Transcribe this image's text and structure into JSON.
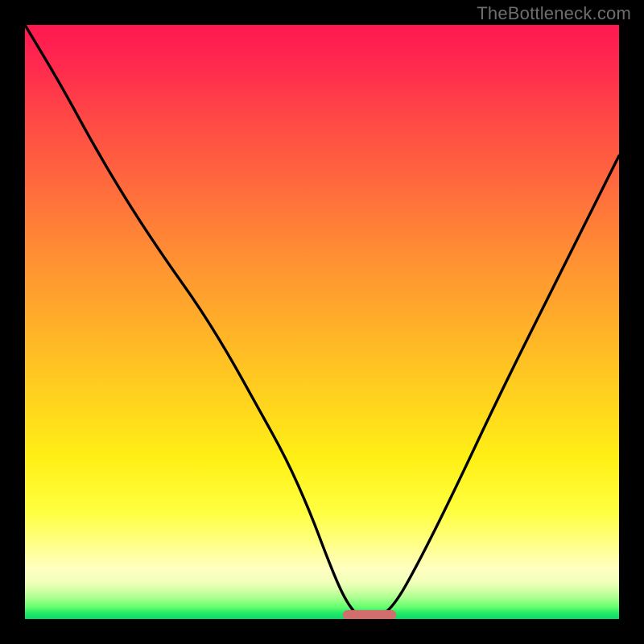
{
  "watermark": {
    "text": "TheBottleneck.com"
  },
  "colors": {
    "page_bg": "#000000",
    "curve_stroke": "#000000",
    "marker_fill": "#d16d6b",
    "gradient_stops": [
      "#ff1850",
      "#ff2a4e",
      "#ff4646",
      "#ff6a3d",
      "#ff8f33",
      "#ffb128",
      "#ffd31e",
      "#fff016",
      "#ffff40",
      "#ffff90",
      "#ffffc0",
      "#f4ffbc",
      "#d7ffa8",
      "#a6ff8d",
      "#63ff6f",
      "#23e968",
      "#0fd76a"
    ]
  },
  "chart_data": {
    "type": "line",
    "title": "",
    "xlabel": "",
    "ylabel": "",
    "xlim": [
      0,
      100
    ],
    "ylim": [
      0,
      100
    ],
    "grid": false,
    "legend": false,
    "series": [
      {
        "name": "bottleneck-curve",
        "x": [
          0,
          6,
          12,
          18,
          24,
          29,
          34,
          39,
          44,
          48,
          51,
          53.5,
          55.5,
          57,
          59,
          62,
          66,
          72,
          80,
          90,
          100
        ],
        "values": [
          100,
          90,
          79,
          69,
          60,
          53,
          45,
          36,
          27,
          18,
          10,
          4,
          1,
          0,
          0,
          2,
          9,
          21,
          38,
          58,
          78
        ]
      }
    ],
    "marker": {
      "name": "optimal-range",
      "shape": "pill",
      "x_start": 53.5,
      "x_end": 62.5,
      "y": 0.7,
      "color": "#d16d6b"
    }
  }
}
